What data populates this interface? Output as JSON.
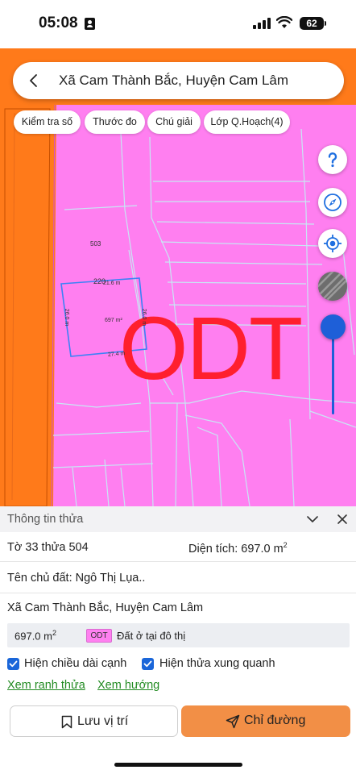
{
  "status_bar": {
    "time": "05:08",
    "battery": "62"
  },
  "search": {
    "location": "Xã Cam Thành Bắc, Huyện Cam Lâm"
  },
  "chips": [
    "Kiểm tra số",
    "Thước đo",
    "Chú giải",
    "Lớp Q.Hoạch(4)"
  ],
  "map": {
    "parcel_numbers": {
      "neighbor": "503",
      "selected": "220"
    },
    "parcel_area": "697 m²",
    "edges": {
      "top": "21.6 m",
      "left": "26.0 m",
      "right": "26.0 m",
      "bottom": "27.4 m"
    },
    "zone_label": "ODT",
    "colors": {
      "land": "#ff7ff0",
      "road": "#ff7a1a",
      "parcel_outline": "#3b82f6",
      "zone_text": "#ff1f2e"
    },
    "icons": [
      "help-icon",
      "compass-icon",
      "locate-icon",
      "satellite-layer-icon"
    ]
  },
  "sheet": {
    "title": "Thông tin thửa",
    "parcel_ref": "Tờ 33 thửa 504",
    "area_label": "Diện tích: 697.0 m",
    "area_sup": "2",
    "owner": "Tên chủ đất: Ngô Thị Lụa..",
    "address": "Xã Cam Thành Bắc, Huyện Cam Lâm",
    "land_area": "697.0 m",
    "land_area_sup": "2",
    "land_code": "ODT",
    "land_use": "Đất ở tại đô thị",
    "checkbox_edges": "Hiện chiều dài cạnh",
    "checkbox_neighbors": "Hiện thửa xung quanh",
    "link_boundary": "Xem ranh thửa",
    "link_direction": "Xem hướng",
    "btn_save": "Lưu vị trí",
    "btn_route": "Chỉ đường"
  }
}
